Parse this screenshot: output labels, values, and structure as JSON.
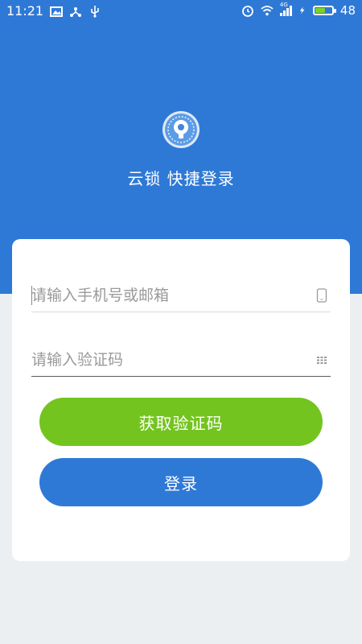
{
  "status_bar": {
    "time": "11:21",
    "battery": "48",
    "network_label": "4G"
  },
  "app": {
    "title": "云锁 快捷登录"
  },
  "form": {
    "account_placeholder": "请输入手机号或邮箱",
    "code_placeholder": "请输入验证码",
    "get_code_label": "获取验证码",
    "login_label": "登录"
  },
  "colors": {
    "primary_blue": "#2f79d6",
    "accent_green": "#74c41f",
    "background": "#eceff2",
    "card": "#ffffff"
  }
}
